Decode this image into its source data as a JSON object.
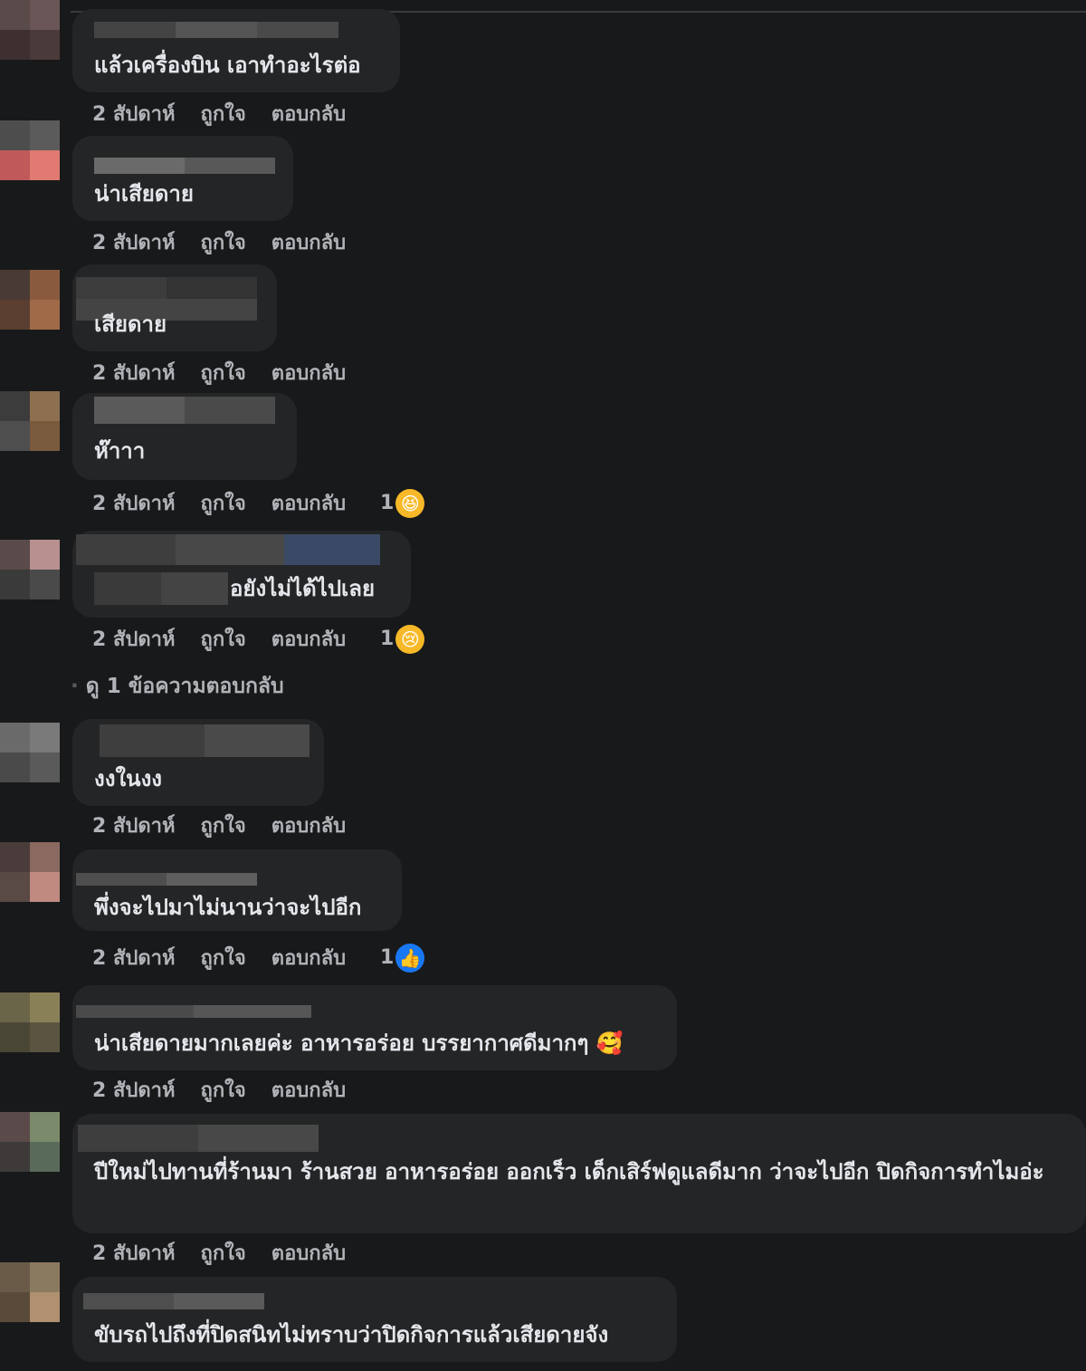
{
  "actions": {
    "time": "2 สัปดาห์",
    "like": "ถูกใจ",
    "reply": "ตอบกลับ"
  },
  "comments": [
    {
      "text": "แล้วเครื่องบิน เอาทำอะไรต่อ"
    },
    {
      "text": "น่าเสียดาย"
    },
    {
      "text": "เสียดาย"
    },
    {
      "text": "ห๊าาา",
      "reaction": {
        "count": "1",
        "icon": "laugh-icon"
      }
    },
    {
      "text": "อยังไม่ได้ไปเลย",
      "reaction": {
        "count": "1",
        "icon": "sad-icon"
      },
      "replies_link": "ดู 1 ข้อความตอบกลับ"
    },
    {
      "text": "งงในงง"
    },
    {
      "text": "พึ่งจะไปมาไม่นานว่าจะไปอีก",
      "reaction": {
        "count": "1",
        "icon": "like-icon"
      }
    },
    {
      "text": "น่าเสียดายมากเลยค่ะ อาหารอร่อย บรรยากาศดีมากๆ 🥰"
    },
    {
      "text": "ปีใหม่ไปทานที่ร้านมา ร้านสวย อาหารอร่อย ออกเร็ว เด็กเสิร์ฟดูแลดีมาก ว่าจะไปอีก ปิดกิจการทำไมอ่ะ"
    },
    {
      "text": "ขับรถไปถึงที่ปิดสนิทไม่ทราบว่าปิดกิจการแล้วเสียดายจัง"
    }
  ],
  "colors": {
    "background": "#18191a",
    "bubble": "#242526",
    "text": "#e4e6eb",
    "meta": "#b0b3b8",
    "like_blue": "#1877f2"
  }
}
